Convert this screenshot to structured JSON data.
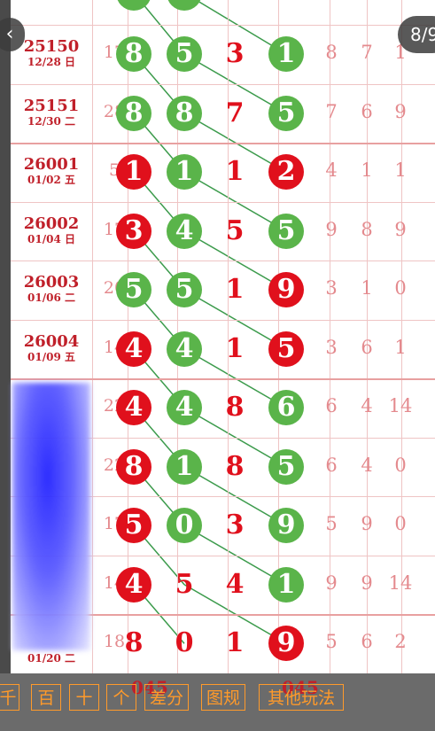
{
  "viewer": {
    "page_indicator": "8/9",
    "back_icon": "chevron-left-icon"
  },
  "rows": [
    {
      "issue": "25150",
      "date": "12/28 日",
      "sum": "17",
      "balls": [
        {
          "v": "8",
          "c": "green"
        },
        {
          "v": "5",
          "c": "green"
        },
        {
          "v": "3",
          "c": "plain"
        },
        {
          "v": "1",
          "c": "green"
        }
      ],
      "tails": [
        "8",
        "7",
        "1"
      ]
    },
    {
      "issue": "25151",
      "date": "12/30 二",
      "sum": "28",
      "balls": [
        {
          "v": "8",
          "c": "green"
        },
        {
          "v": "8",
          "c": "green"
        },
        {
          "v": "7",
          "c": "plain"
        },
        {
          "v": "5",
          "c": "green"
        }
      ],
      "tails": [
        "7",
        "6",
        "9"
      ]
    },
    {
      "issue": "26001",
      "date": "01/02 五",
      "sum": "5",
      "balls": [
        {
          "v": "1",
          "c": "red"
        },
        {
          "v": "1",
          "c": "green"
        },
        {
          "v": "1",
          "c": "plain"
        },
        {
          "v": "2",
          "c": "red"
        }
      ],
      "tails": [
        "4",
        "1",
        "1"
      ]
    },
    {
      "issue": "26002",
      "date": "01/04 日",
      "sum": "17",
      "balls": [
        {
          "v": "3",
          "c": "red"
        },
        {
          "v": "4",
          "c": "green"
        },
        {
          "v": "5",
          "c": "plain"
        },
        {
          "v": "5",
          "c": "green"
        }
      ],
      "tails": [
        "9",
        "8",
        "9"
      ]
    },
    {
      "issue": "26003",
      "date": "01/06 二",
      "sum": "20",
      "balls": [
        {
          "v": "5",
          "c": "green"
        },
        {
          "v": "5",
          "c": "green"
        },
        {
          "v": "1",
          "c": "plain"
        },
        {
          "v": "9",
          "c": "red"
        }
      ],
      "tails": [
        "3",
        "1",
        "0"
      ]
    },
    {
      "issue": "26004",
      "date": "01/09 五",
      "sum": "14",
      "balls": [
        {
          "v": "4",
          "c": "red"
        },
        {
          "v": "4",
          "c": "green"
        },
        {
          "v": "1",
          "c": "plain"
        },
        {
          "v": "5",
          "c": "red"
        }
      ],
      "tails": [
        "3",
        "6",
        "1"
      ]
    },
    {
      "issue": "",
      "date": "",
      "sum": "22",
      "balls": [
        {
          "v": "4",
          "c": "red"
        },
        {
          "v": "4",
          "c": "green"
        },
        {
          "v": "8",
          "c": "plain"
        },
        {
          "v": "6",
          "c": "green"
        }
      ],
      "tails": [
        "6",
        "4",
        "14"
      ]
    },
    {
      "issue": "",
      "date": "",
      "sum": "22",
      "balls": [
        {
          "v": "8",
          "c": "red"
        },
        {
          "v": "1",
          "c": "green"
        },
        {
          "v": "8",
          "c": "plain"
        },
        {
          "v": "5",
          "c": "green"
        }
      ],
      "tails": [
        "6",
        "4",
        "0"
      ]
    },
    {
      "issue": "",
      "date": "",
      "sum": "17",
      "balls": [
        {
          "v": "5",
          "c": "red"
        },
        {
          "v": "0",
          "c": "green"
        },
        {
          "v": "3",
          "c": "plain"
        },
        {
          "v": "9",
          "c": "green"
        }
      ],
      "tails": [
        "5",
        "9",
        "0"
      ]
    },
    {
      "issue": "",
      "date": "",
      "sum": "14",
      "balls": [
        {
          "v": "4",
          "c": "red"
        },
        {
          "v": "5",
          "c": "plain"
        },
        {
          "v": "4",
          "c": "plain"
        },
        {
          "v": "1",
          "c": "green"
        }
      ],
      "tails": [
        "9",
        "9",
        "14"
      ]
    },
    {
      "issue": "",
      "date": "01/20 二",
      "sum": "18",
      "balls": [
        {
          "v": "8",
          "c": "plain"
        },
        {
          "v": "0",
          "c": "plain"
        },
        {
          "v": "1",
          "c": "plain"
        },
        {
          "v": "9",
          "c": "red"
        }
      ],
      "tails": [
        "5",
        "6",
        "2"
      ]
    }
  ],
  "toolbar": {
    "buttons": [
      "千",
      "百",
      "十",
      "个",
      "差分",
      "图规",
      "其他玩法"
    ]
  },
  "colors": {
    "red_ball": "#e0101c",
    "green_ball": "#5ab44a",
    "grid": "#efc4c4",
    "button_orange": "#ff9a2a"
  }
}
